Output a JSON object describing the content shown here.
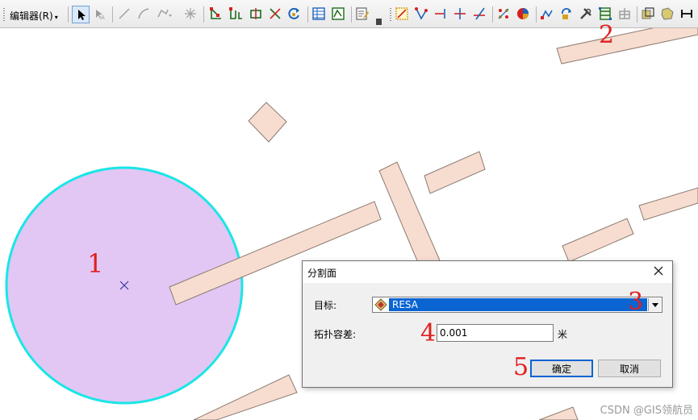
{
  "toolbar": {
    "editor_menu_label": "编辑器(R)",
    "editor_menu_arrow": "▾"
  },
  "annotations": {
    "n1": "1",
    "n2": "2",
    "n3": "3",
    "n4": "4",
    "n5": "5"
  },
  "dialog": {
    "title": "分割面",
    "target_label": "目标:",
    "target_value": "RESA",
    "tolerance_label": "拓扑容差:",
    "tolerance_value": "0.001",
    "unit_label": "米",
    "ok_label": "确定",
    "cancel_label": "取消"
  },
  "watermark": "CSDN @GIS领航员",
  "colors": {
    "circle_fill": "#e2c6f4",
    "circle_stroke": "#19e6e6",
    "feature_fill": "#f7ddd0",
    "selection_blue": "#0a64d2",
    "annotation_red": "#e02020"
  }
}
